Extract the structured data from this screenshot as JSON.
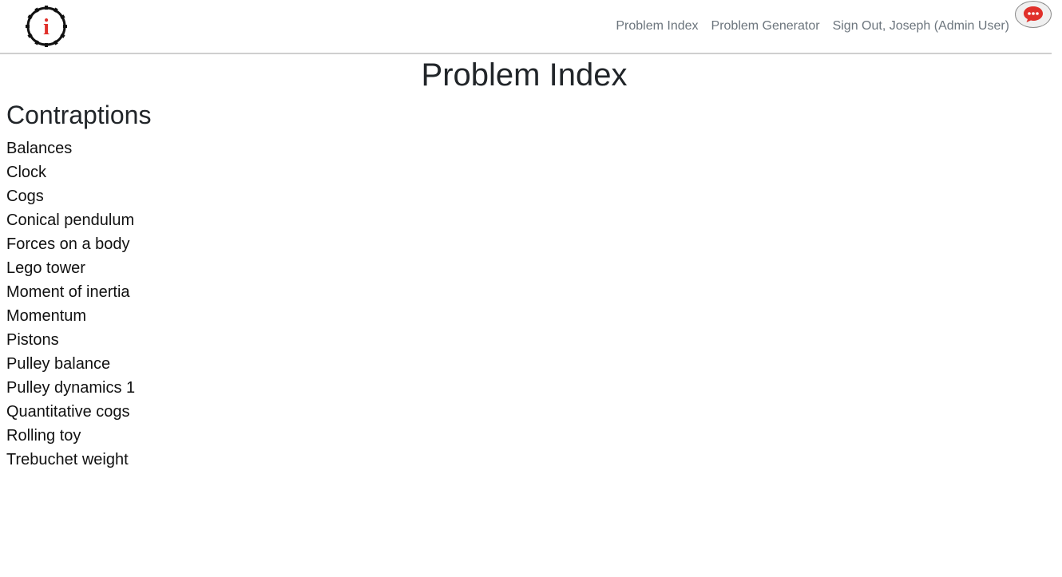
{
  "nav": {
    "links": [
      {
        "label": "Problem Index"
      },
      {
        "label": "Problem Generator"
      },
      {
        "label": "Sign Out, Joseph (Admin User)"
      }
    ]
  },
  "logo": {
    "icon": "gear-info-icon",
    "glyph": "i",
    "accent": "#e0302a"
  },
  "chat": {
    "icon": "chat-bubble-icon",
    "color": "#e0302a"
  },
  "page": {
    "title": "Problem Index"
  },
  "section": {
    "title": "Contraptions",
    "items": [
      "Balances",
      "Clock",
      "Cogs",
      "Conical pendulum",
      "Forces on a body",
      "Lego tower",
      "Moment of inertia",
      "Momentum",
      "Pistons",
      "Pulley balance",
      "Pulley dynamics 1",
      "Quantitative cogs",
      "Rolling toy",
      "Trebuchet weight"
    ]
  }
}
